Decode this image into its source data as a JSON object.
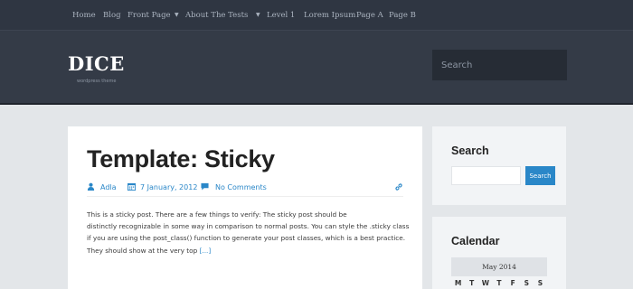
{
  "nav": {
    "items": [
      "Home",
      "Blog",
      "Front Page",
      "About The Tests",
      "Level 1",
      "Lorem Ipsum",
      "Page A",
      "Page B"
    ],
    "arrow": "▼"
  },
  "header": {
    "logo": "DICE",
    "tagline": "wordpress theme",
    "search_placeholder": "Search"
  },
  "post": {
    "title": "Template: Sticky",
    "author": "Adla",
    "date": "7 January, 2012",
    "comments": "No Comments",
    "excerpt_lines": [
      "This is a sticky post. There are a few things to verify: The sticky post should be",
      "distinctly recognizable in some way in comparison to normal posts. You can style the .sticky class",
      "if you are using the post_class() function to generate your post classes, which is a best practice.",
      "They should show at the very top "
    ],
    "more": "[...]"
  },
  "sidebar": {
    "search": {
      "title": "Search",
      "button": "Search"
    },
    "calendar": {
      "title": "Calendar",
      "caption": "May 2014",
      "days": [
        "M",
        "T",
        "W",
        "T",
        "F",
        "S",
        "S"
      ]
    }
  },
  "colors": {
    "accent": "#2a87c8",
    "nav_bg": "#2f3642",
    "header_bg": "#343b47",
    "page_bg": "#e3e6e9"
  },
  "icons": {
    "author": "user-icon",
    "date": "calendar-icon",
    "comments": "comment-icon",
    "permalink": "link-icon"
  }
}
